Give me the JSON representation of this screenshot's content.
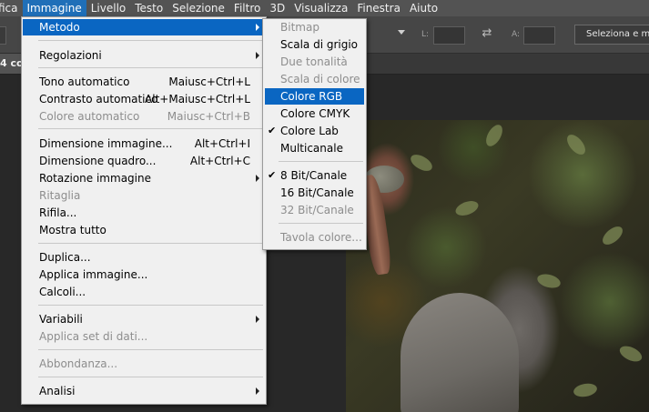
{
  "menubar": {
    "items": [
      "fica",
      "Immagine",
      "Livello",
      "Testo",
      "Selezione",
      "Filtro",
      "3D",
      "Visualizza",
      "Finestra",
      "Aiuto"
    ],
    "active_index": 1
  },
  "optionsbar": {
    "width_label": "L:",
    "height_label": "A:",
    "select_mask_button": "Seleziona e maschera..."
  },
  "document_tab": {
    "title": "4 co"
  },
  "image_menu": {
    "metodo": "Metodo",
    "regolazioni": "Regolazioni",
    "tono_automatico": {
      "label": "Tono automatico",
      "shortcut": "Maiusc+Ctrl+L"
    },
    "contrasto_automatico": {
      "label": "Contrasto automatico",
      "shortcut": "Alt+Maiusc+Ctrl+L"
    },
    "colore_automatico": {
      "label": "Colore automatico",
      "shortcut": "Maiusc+Ctrl+B"
    },
    "dimensione_immagine": {
      "label": "Dimensione immagine...",
      "shortcut": "Alt+Ctrl+I"
    },
    "dimensione_quadro": {
      "label": "Dimensione quadro...",
      "shortcut": "Alt+Ctrl+C"
    },
    "rotazione_immagine": "Rotazione immagine",
    "ritaglia": "Ritaglia",
    "rifila": "Rifila...",
    "mostra_tutto": "Mostra tutto",
    "duplica": "Duplica...",
    "applica_immagine": "Applica immagine...",
    "calcoli": "Calcoli...",
    "variabili": "Variabili",
    "applica_set_dati": "Applica set di dati...",
    "abbondanza": "Abbondanza...",
    "analisi": "Analisi"
  },
  "mode_submenu": {
    "bitmap": "Bitmap",
    "scala_grigio": "Scala di grigio",
    "due_tonalita": "Due tonalità",
    "scala_colore": "Scala di colore",
    "colore_rgb": "Colore RGB",
    "colore_cmyk": "Colore CMYK",
    "colore_lab": "Colore Lab",
    "multicanale": "Multicanale",
    "bit8": "8 Bit/Canale",
    "bit16": "16 Bit/Canale",
    "bit32": "32 Bit/Canale",
    "tavola_colore": "Tavola colore...",
    "check_glyph": "✔"
  }
}
